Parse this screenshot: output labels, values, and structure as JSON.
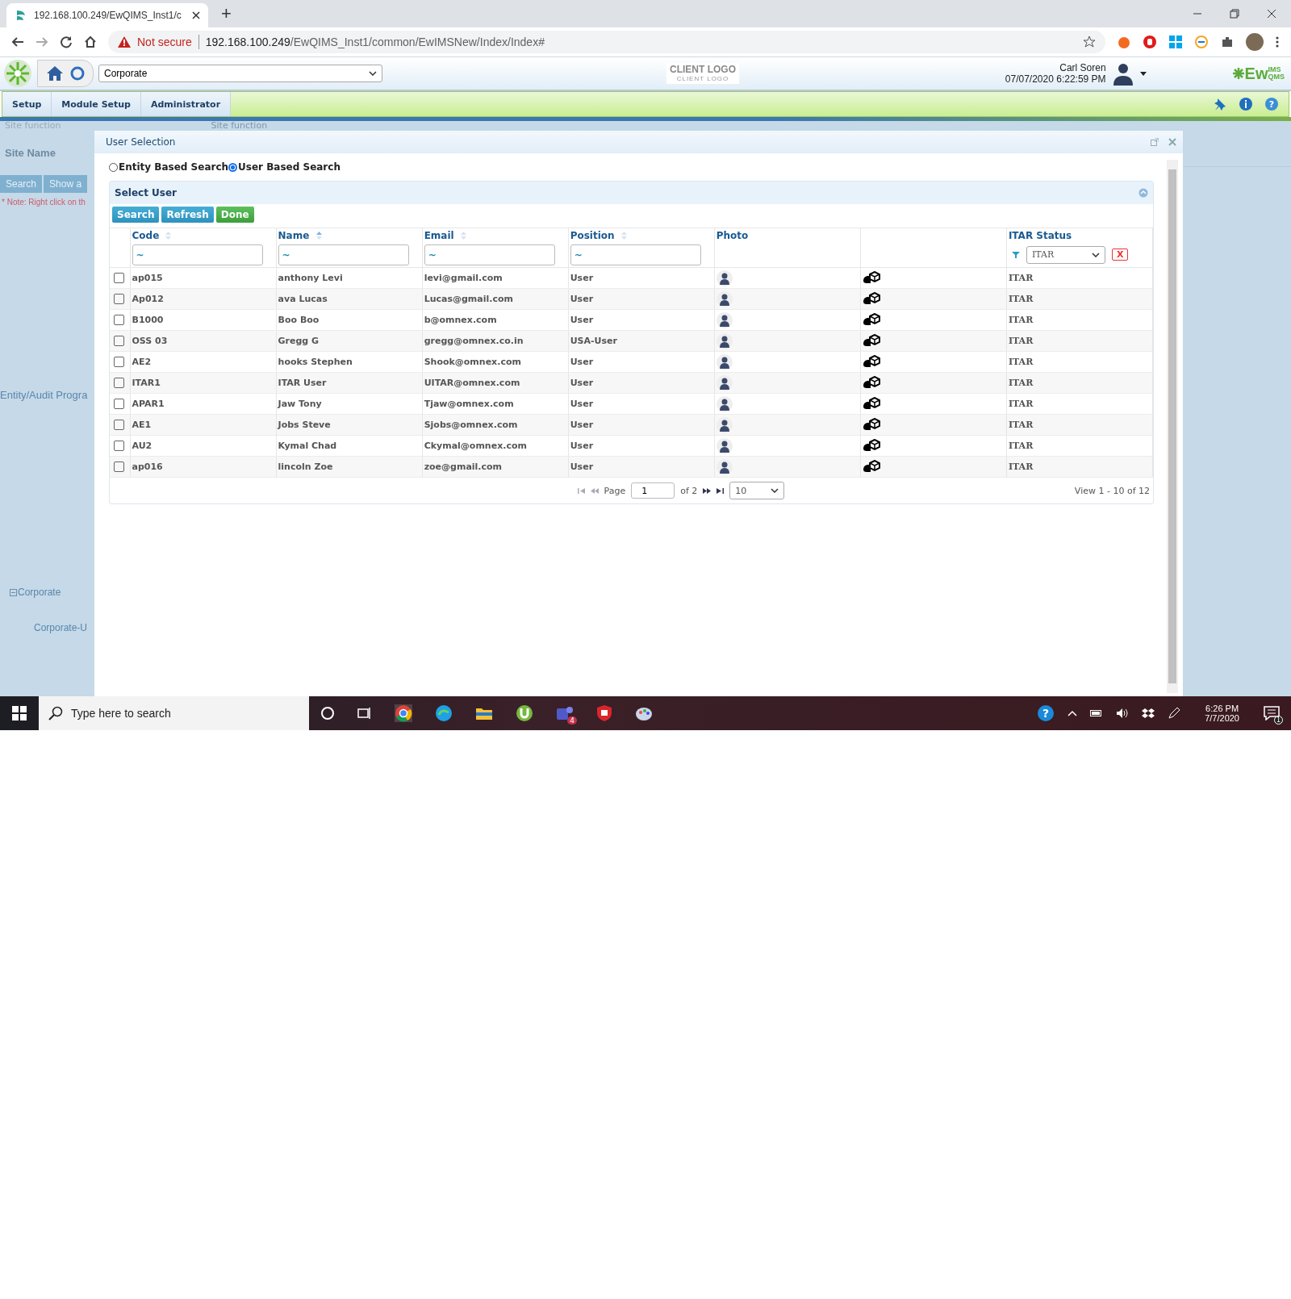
{
  "browser": {
    "tab_title": "192.168.100.249/EwQIMS_Inst1/c",
    "new_tab": "+",
    "warning": "Not secure",
    "url_host": "192.168.100.249",
    "url_path": "/EwQIMS_Inst1/common/EwIMSNew/Index/Index#"
  },
  "app_header": {
    "site_select": "Corporate",
    "client_logo": "CLIENT LOGO",
    "client_logo_sub": "CLIENT LOGO",
    "user_name": "Carl Soren",
    "datetime": "07/07/2020 6:22:59 PM",
    "brand": "Ew",
    "brand_top": "IMS",
    "brand_bottom": "QMS"
  },
  "help_glyph": "?",
  "menu": [
    {
      "label": "Setup"
    },
    {
      "label": "Module Setup"
    },
    {
      "label": "Administrator"
    }
  ],
  "background": {
    "top_left": "Site function",
    "top_middle": "Site function",
    "site_name": "Site Name",
    "buttons": [
      "Search",
      "Show a"
    ],
    "note": "* Note: Right click on th",
    "entity_label": "Entity/Audit Progra",
    "tree": [
      {
        "label": "Corporate",
        "expanded": true,
        "children": [
          {
            "label": "Corporate-U"
          }
        ]
      }
    ]
  },
  "dialog": {
    "title": "User Selection",
    "search_modes": [
      {
        "label": "Entity Based Search",
        "selected": false
      },
      {
        "label": "User Based Search",
        "selected": true
      }
    ],
    "panel_title": "Select User",
    "buttons": [
      {
        "label": "Search",
        "kind": "primary"
      },
      {
        "label": "Refresh",
        "kind": "primary"
      },
      {
        "label": "Done",
        "kind": "success"
      }
    ],
    "columns": [
      {
        "label": "Code",
        "sorted": false,
        "filter": {
          "kind": "text",
          "value": "~"
        }
      },
      {
        "label": "Name",
        "sorted": true,
        "filter": {
          "kind": "text",
          "value": "~"
        }
      },
      {
        "label": "Email",
        "sorted": false,
        "filter": {
          "kind": "text",
          "value": "~"
        }
      },
      {
        "label": "Position",
        "sorted": false,
        "filter": {
          "kind": "text",
          "value": "~"
        }
      },
      {
        "label": "Photo"
      },
      {},
      {
        "label": "ITAR Status",
        "filter": {
          "kind": "select",
          "value": "ITAR",
          "clear": "X"
        }
      }
    ],
    "rows": [
      {
        "checked": false,
        "code": "ap015",
        "name": "anthony Levi",
        "email": "levi@gmail.com",
        "position": "User",
        "itar": "ITAR"
      },
      {
        "checked": false,
        "code": "Ap012",
        "name": "ava Lucas",
        "email": "Lucas@gmail.com",
        "position": "User",
        "itar": "ITAR"
      },
      {
        "checked": false,
        "code": "B1000",
        "name": "Boo Boo",
        "email": "b@omnex.com",
        "position": "User",
        "itar": "ITAR"
      },
      {
        "checked": false,
        "code": "OSS 03",
        "name": "Gregg G",
        "email": "gregg@omnex.co.in",
        "position": "USA-User",
        "itar": "ITAR"
      },
      {
        "checked": false,
        "code": "AE2",
        "name": "hooks Stephen",
        "email": "Shook@omnex.com",
        "position": "User",
        "itar": "ITAR"
      },
      {
        "checked": false,
        "code": "ITAR1",
        "name": "ITAR User",
        "email": "UITAR@omnex.com",
        "position": "User",
        "itar": "ITAR"
      },
      {
        "checked": false,
        "code": "APAR1",
        "name": "Jaw Tony",
        "email": "Tjaw@omnex.com",
        "position": "User",
        "itar": "ITAR"
      },
      {
        "checked": false,
        "code": "AE1",
        "name": "Jobs Steve",
        "email": "Sjobs@omnex.com",
        "position": "User",
        "itar": "ITAR"
      },
      {
        "checked": false,
        "code": "AU2",
        "name": "Kymal Chad",
        "email": "Ckymal@omnex.com",
        "position": "User",
        "itar": "ITAR"
      },
      {
        "checked": false,
        "code": "ap016",
        "name": "lincoln Zoe",
        "email": "zoe@gmail.com",
        "position": "User",
        "itar": "ITAR"
      }
    ],
    "pager": {
      "page_label": "Page",
      "page": "1",
      "of": "of 2",
      "page_size": "10",
      "view": "View 1 - 10 of 12"
    }
  },
  "taskbar": {
    "help_glyph": "?",
    "search_placeholder": "Type here to search",
    "teams_badge": "4",
    "time": "6:26 PM",
    "date": "7/7/2020",
    "notifications": "1"
  }
}
